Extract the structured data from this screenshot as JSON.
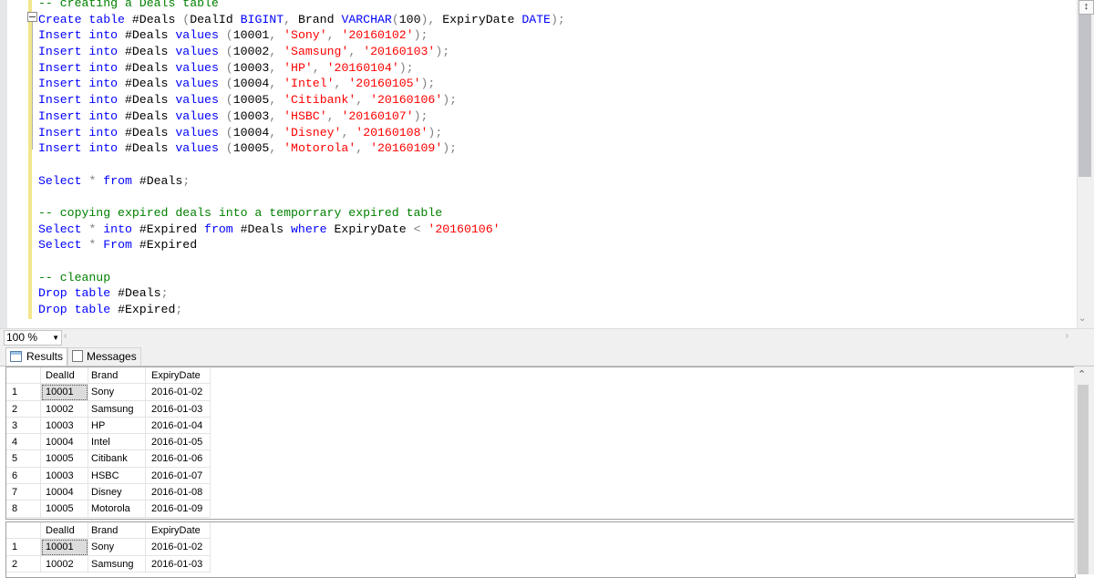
{
  "editor": {
    "lines": [
      [
        {
          "t": "-- creating a Deals table",
          "c": "cmt"
        }
      ],
      [
        {
          "t": "Create",
          "c": "kw"
        },
        {
          "t": " "
        },
        {
          "t": "table",
          "c": "kw"
        },
        {
          "t": " #Deals "
        },
        {
          "t": "(",
          "c": "gry"
        },
        {
          "t": "DealId "
        },
        {
          "t": "BIGINT",
          "c": "kw"
        },
        {
          "t": ",",
          "c": "gry"
        },
        {
          "t": " Brand "
        },
        {
          "t": "VARCHAR",
          "c": "kw"
        },
        {
          "t": "(",
          "c": "gry"
        },
        {
          "t": "100"
        },
        {
          "t": "),",
          "c": "gry"
        },
        {
          "t": " ExpiryDate "
        },
        {
          "t": "DATE",
          "c": "kw"
        },
        {
          "t": ");",
          "c": "gry"
        }
      ],
      [
        {
          "t": "Insert",
          "c": "kw"
        },
        {
          "t": " "
        },
        {
          "t": "into",
          "c": "kw"
        },
        {
          "t": " #Deals "
        },
        {
          "t": "values",
          "c": "kw"
        },
        {
          "t": " "
        },
        {
          "t": "(",
          "c": "gry"
        },
        {
          "t": "10001"
        },
        {
          "t": ",",
          "c": "gry"
        },
        {
          "t": " "
        },
        {
          "t": "'Sony'",
          "c": "str"
        },
        {
          "t": ",",
          "c": "gry"
        },
        {
          "t": " "
        },
        {
          "t": "'20160102'",
          "c": "str"
        },
        {
          "t": ");",
          "c": "gry"
        }
      ],
      [
        {
          "t": "Insert",
          "c": "kw"
        },
        {
          "t": " "
        },
        {
          "t": "into",
          "c": "kw"
        },
        {
          "t": " #Deals "
        },
        {
          "t": "values",
          "c": "kw"
        },
        {
          "t": " "
        },
        {
          "t": "(",
          "c": "gry"
        },
        {
          "t": "10002"
        },
        {
          "t": ",",
          "c": "gry"
        },
        {
          "t": " "
        },
        {
          "t": "'Samsung'",
          "c": "str"
        },
        {
          "t": ",",
          "c": "gry"
        },
        {
          "t": " "
        },
        {
          "t": "'20160103'",
          "c": "str"
        },
        {
          "t": ");",
          "c": "gry"
        }
      ],
      [
        {
          "t": "Insert",
          "c": "kw"
        },
        {
          "t": " "
        },
        {
          "t": "into",
          "c": "kw"
        },
        {
          "t": " #Deals "
        },
        {
          "t": "values",
          "c": "kw"
        },
        {
          "t": " "
        },
        {
          "t": "(",
          "c": "gry"
        },
        {
          "t": "10003"
        },
        {
          "t": ",",
          "c": "gry"
        },
        {
          "t": " "
        },
        {
          "t": "'HP'",
          "c": "str"
        },
        {
          "t": ",",
          "c": "gry"
        },
        {
          "t": " "
        },
        {
          "t": "'20160104'",
          "c": "str"
        },
        {
          "t": ");",
          "c": "gry"
        }
      ],
      [
        {
          "t": "Insert",
          "c": "kw"
        },
        {
          "t": " "
        },
        {
          "t": "into",
          "c": "kw"
        },
        {
          "t": " #Deals "
        },
        {
          "t": "values",
          "c": "kw"
        },
        {
          "t": " "
        },
        {
          "t": "(",
          "c": "gry"
        },
        {
          "t": "10004"
        },
        {
          "t": ",",
          "c": "gry"
        },
        {
          "t": " "
        },
        {
          "t": "'Intel'",
          "c": "str"
        },
        {
          "t": ",",
          "c": "gry"
        },
        {
          "t": " "
        },
        {
          "t": "'20160105'",
          "c": "str"
        },
        {
          "t": ");",
          "c": "gry"
        }
      ],
      [
        {
          "t": "Insert",
          "c": "kw"
        },
        {
          "t": " "
        },
        {
          "t": "into",
          "c": "kw"
        },
        {
          "t": " #Deals "
        },
        {
          "t": "values",
          "c": "kw"
        },
        {
          "t": " "
        },
        {
          "t": "(",
          "c": "gry"
        },
        {
          "t": "10005"
        },
        {
          "t": ",",
          "c": "gry"
        },
        {
          "t": " "
        },
        {
          "t": "'Citibank'",
          "c": "str"
        },
        {
          "t": ",",
          "c": "gry"
        },
        {
          "t": " "
        },
        {
          "t": "'20160106'",
          "c": "str"
        },
        {
          "t": ");",
          "c": "gry"
        }
      ],
      [
        {
          "t": "Insert",
          "c": "kw"
        },
        {
          "t": " "
        },
        {
          "t": "into",
          "c": "kw"
        },
        {
          "t": " #Deals "
        },
        {
          "t": "values",
          "c": "kw"
        },
        {
          "t": " "
        },
        {
          "t": "(",
          "c": "gry"
        },
        {
          "t": "10003"
        },
        {
          "t": ",",
          "c": "gry"
        },
        {
          "t": " "
        },
        {
          "t": "'HSBC'",
          "c": "str"
        },
        {
          "t": ",",
          "c": "gry"
        },
        {
          "t": " "
        },
        {
          "t": "'20160107'",
          "c": "str"
        },
        {
          "t": ");",
          "c": "gry"
        }
      ],
      [
        {
          "t": "Insert",
          "c": "kw"
        },
        {
          "t": " "
        },
        {
          "t": "into",
          "c": "kw"
        },
        {
          "t": " #Deals "
        },
        {
          "t": "values",
          "c": "kw"
        },
        {
          "t": " "
        },
        {
          "t": "(",
          "c": "gry"
        },
        {
          "t": "10004"
        },
        {
          "t": ",",
          "c": "gry"
        },
        {
          "t": " "
        },
        {
          "t": "'Disney'",
          "c": "str"
        },
        {
          "t": ",",
          "c": "gry"
        },
        {
          "t": " "
        },
        {
          "t": "'20160108'",
          "c": "str"
        },
        {
          "t": ");",
          "c": "gry"
        }
      ],
      [
        {
          "t": "Insert",
          "c": "kw"
        },
        {
          "t": " "
        },
        {
          "t": "into",
          "c": "kw"
        },
        {
          "t": " #Deals "
        },
        {
          "t": "values",
          "c": "kw"
        },
        {
          "t": " "
        },
        {
          "t": "(",
          "c": "gry"
        },
        {
          "t": "10005"
        },
        {
          "t": ",",
          "c": "gry"
        },
        {
          "t": " "
        },
        {
          "t": "'Motorola'",
          "c": "str"
        },
        {
          "t": ",",
          "c": "gry"
        },
        {
          "t": " "
        },
        {
          "t": "'20160109'",
          "c": "str"
        },
        {
          "t": ");",
          "c": "gry"
        }
      ],
      [],
      [
        {
          "t": "Select",
          "c": "kw"
        },
        {
          "t": " "
        },
        {
          "t": "*",
          "c": "gry"
        },
        {
          "t": " "
        },
        {
          "t": "from",
          "c": "kw"
        },
        {
          "t": " #Deals"
        },
        {
          "t": ";",
          "c": "gry"
        }
      ],
      [],
      [
        {
          "t": "-- copying expired deals into a temporrary expired table",
          "c": "cmt"
        }
      ],
      [
        {
          "t": "Select",
          "c": "kw"
        },
        {
          "t": " "
        },
        {
          "t": "*",
          "c": "gry"
        },
        {
          "t": " "
        },
        {
          "t": "into",
          "c": "kw"
        },
        {
          "t": " #Expired "
        },
        {
          "t": "from",
          "c": "kw"
        },
        {
          "t": " #Deals "
        },
        {
          "t": "where",
          "c": "kw"
        },
        {
          "t": " ExpiryDate "
        },
        {
          "t": "<",
          "c": "gry"
        },
        {
          "t": " "
        },
        {
          "t": "'20160106'",
          "c": "str"
        }
      ],
      [
        {
          "t": "Select",
          "c": "kw"
        },
        {
          "t": " "
        },
        {
          "t": "*",
          "c": "gry"
        },
        {
          "t": " "
        },
        {
          "t": "From",
          "c": "kw"
        },
        {
          "t": " #Expired"
        }
      ],
      [],
      [
        {
          "t": "-- cleanup",
          "c": "cmt"
        }
      ],
      [
        {
          "t": "Drop",
          "c": "kw"
        },
        {
          "t": " "
        },
        {
          "t": "table",
          "c": "kw"
        },
        {
          "t": " #Deals"
        },
        {
          "t": ";",
          "c": "gry"
        }
      ],
      [
        {
          "t": "Drop",
          "c": "kw"
        },
        {
          "t": " "
        },
        {
          "t": "table",
          "c": "kw"
        },
        {
          "t": " #Expired"
        },
        {
          "t": ";",
          "c": "gry"
        }
      ]
    ]
  },
  "zoom": {
    "value": "100 %"
  },
  "tabs": {
    "results": "Results",
    "messages": "Messages"
  },
  "grid1": {
    "columns": [
      "DealId",
      "Brand",
      "ExpiryDate"
    ],
    "rows": [
      [
        "1",
        "10001",
        "Sony",
        "2016-01-02"
      ],
      [
        "2",
        "10002",
        "Samsung",
        "2016-01-03"
      ],
      [
        "3",
        "10003",
        "HP",
        "2016-01-04"
      ],
      [
        "4",
        "10004",
        "Intel",
        "2016-01-05"
      ],
      [
        "5",
        "10005",
        "Citibank",
        "2016-01-06"
      ],
      [
        "6",
        "10003",
        "HSBC",
        "2016-01-07"
      ],
      [
        "7",
        "10004",
        "Disney",
        "2016-01-08"
      ],
      [
        "8",
        "10005",
        "Motorola",
        "2016-01-09"
      ]
    ]
  },
  "grid2": {
    "columns": [
      "DealId",
      "Brand",
      "ExpiryDate"
    ],
    "rows": [
      [
        "1",
        "10001",
        "Sony",
        "2016-01-02"
      ],
      [
        "2",
        "10002",
        "Samsung",
        "2016-01-03"
      ]
    ]
  },
  "colors": {
    "keyword": "#0000ff",
    "string": "#ff0000",
    "comment": "#008000",
    "operator": "#808080"
  }
}
